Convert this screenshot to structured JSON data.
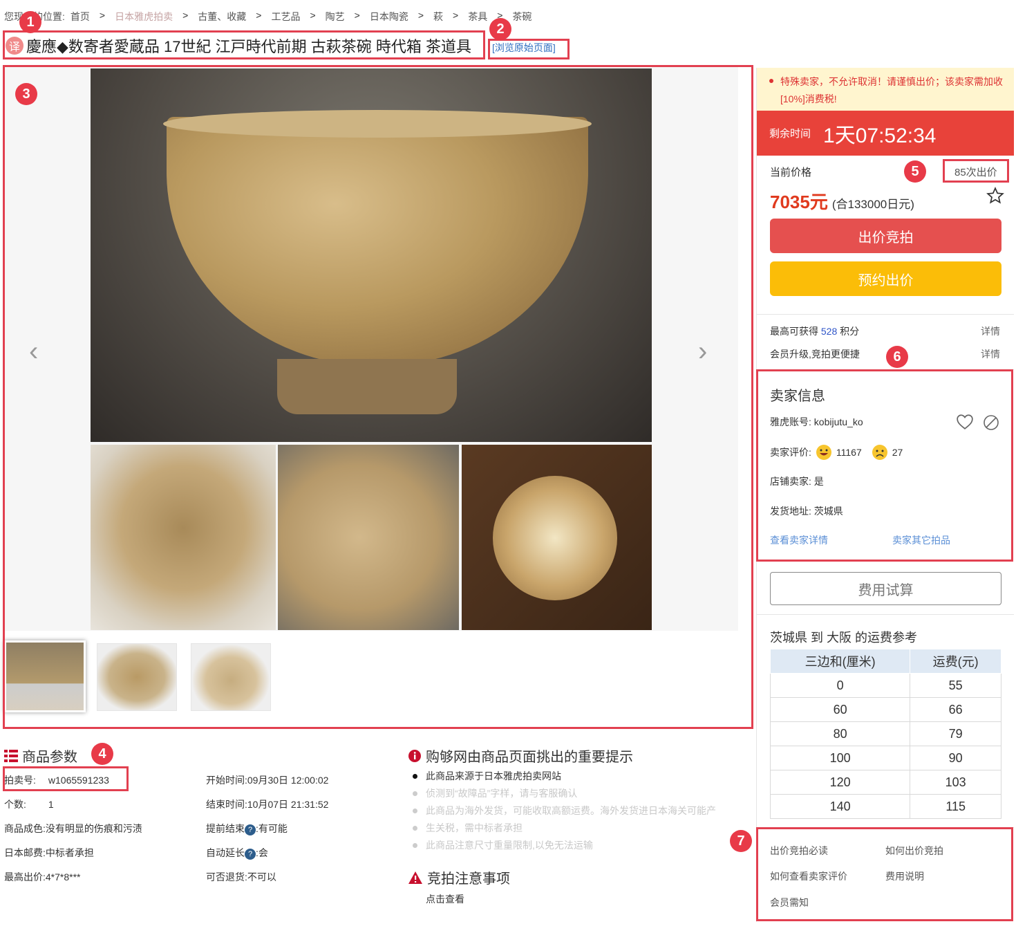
{
  "breadcrumb": {
    "prefix": "您现在的位置:",
    "items": [
      "首页",
      "日本雅虎拍卖",
      "古董、收藏",
      "工艺品",
      "陶艺",
      "日本陶瓷",
      "萩",
      "茶具",
      "茶碗"
    ]
  },
  "title": {
    "translate_badge": "译",
    "text": "慶應◆数寄者愛蔵品 17世紀 江戸時代前期 古萩茶碗 時代箱 茶道具",
    "original_link": "[浏览原始页面]"
  },
  "markers": [
    "1",
    "2",
    "3",
    "4",
    "5",
    "6",
    "7"
  ],
  "gallery": {
    "prev_arrow": "‹",
    "next_arrow": "›"
  },
  "params": {
    "heading": "商品参数",
    "left": [
      {
        "label": "拍卖号:",
        "value": "w1065591233"
      },
      {
        "label": "个数:",
        "value": "1"
      },
      {
        "label": "商品成色:",
        "value": "没有明显的伤痕和污渍"
      },
      {
        "label": "日本邮费:",
        "value": "中标者承担"
      },
      {
        "label": "最高出价:",
        "value": "4*7*8***"
      }
    ],
    "right": [
      {
        "label": "开始时间:",
        "value": "09月30日 12:00:02"
      },
      {
        "label": "结束时间:",
        "value": "10月07日 21:31:52"
      },
      {
        "label": "提前结束",
        "help": "?",
        "value": ":有可能"
      },
      {
        "label": "自动延长",
        "help": "?",
        "value": ":会"
      },
      {
        "label": "可否退货:",
        "value": "不可以"
      }
    ]
  },
  "tips": {
    "heading": "购够网由商品页面挑出的重要提示",
    "items": [
      "此商品来源于日本雅虎拍卖网站",
      "侦测到“故障品”字样，请与客服确认",
      "此商品为海外发货，可能收取高额运费。海外发货进日本海关可能产",
      "生关税，需中标者承担",
      "此商品注意尺寸重量限制,以免无法运输"
    ],
    "notice_heading": "竞拍注意事项",
    "notice_link": "点击查看"
  },
  "sidebar": {
    "warning": "特殊卖家，不允许取消！请谨慎出价；该卖家需加收[10%]消费税!",
    "timer_label": "剩余时间",
    "timer_value": "1天07:52:34",
    "price_label": "当前价格",
    "bid_count": "85次出价",
    "price": "7035元",
    "price_jpy": "(合133000日元)",
    "bid_button": "出价竞拍",
    "reserve_button": "预约出价",
    "points_prefix": "最高可获得",
    "points_value": "528",
    "points_suffix": "积分",
    "detail": "详情",
    "member_text": "会员升级,竞拍更便捷",
    "seller": {
      "heading": "卖家信息",
      "account_label": "雅虎账号:",
      "account": "kobijutu_ko",
      "rating_label": "卖家评价:",
      "good": "11167",
      "bad": "27",
      "store_label": "店铺卖家:",
      "store": "是",
      "ship_label": "发货地址:",
      "ship_from": "茨城県",
      "link_detail": "查看卖家详情",
      "link_other": "卖家其它拍品"
    },
    "fee_button": "费用试算",
    "shipping": {
      "title": "茨城県 到 大阪 的运费参考",
      "headers": [
        "三边和(厘米)",
        "运费(元)"
      ],
      "rows": [
        [
          "0",
          "55"
        ],
        [
          "60",
          "66"
        ],
        [
          "80",
          "79"
        ],
        [
          "100",
          "90"
        ],
        [
          "120",
          "103"
        ],
        [
          "140",
          "115"
        ]
      ]
    },
    "help_links": [
      "出价竞拍必读",
      "如何出价竞拍",
      "如何查看卖家评价",
      "费用说明",
      "会员需知"
    ]
  }
}
